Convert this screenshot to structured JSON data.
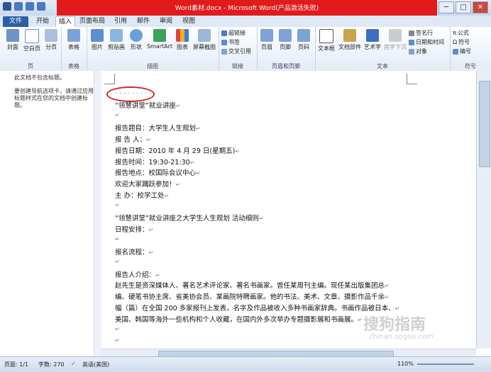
{
  "window": {
    "title": "Word素材.docx - Microsoft Word(产品激活失败)",
    "min": "─",
    "max": "□",
    "close": "✕"
  },
  "tabs": [
    "文件",
    "开始",
    "插入",
    "页面布局",
    "引用",
    "邮件",
    "审阅",
    "视图"
  ],
  "active_tab": "插入",
  "ribbon": {
    "groups": [
      {
        "label": "页",
        "buttons": [
          "封面",
          "空白页",
          "分页"
        ]
      },
      {
        "label": "表格",
        "buttons": [
          "表格"
        ]
      },
      {
        "label": "插图",
        "buttons": [
          "图片",
          "剪贴画",
          "形状",
          "SmartArt",
          "图表",
          "屏幕截图"
        ]
      },
      {
        "label": "链接",
        "buttons": [
          "超链接",
          "书签",
          "交叉引用"
        ]
      },
      {
        "label": "页眉和页脚",
        "buttons": [
          "页眉",
          "页脚",
          "页码"
        ]
      },
      {
        "label": "文本",
        "buttons": [
          "文本框",
          "文档部件",
          "艺术字",
          "首字下沉",
          "签名行",
          "日期和时间",
          "对象"
        ]
      },
      {
        "label": "符号",
        "buttons": [
          "公式",
          "符号",
          "编号"
        ]
      }
    ]
  },
  "nav_pane": {
    "no_headings": "此文档不包含标题。",
    "hint": "要创建导航选项卡，请通过应用标题样式在您的文档中创建标题。"
  },
  "document": {
    "lines": [
      "“领慧讲堂”就业讲座",
      "",
      "报告题目：大学生人生规划",
      "报 告 人：",
      "报告日期：2010 年 4 月 29 日(星期五)",
      "报告时间：19:30-21:30",
      "报告地点：校国际会议中心",
      "欢迎大家踊跃参加！",
      "主 办：校学工处",
      "",
      "“领慧讲堂”就业讲座之大学生人生规划  活动细则",
      "日程安排：",
      "",
      "报名流程：",
      "",
      "报告人介绍：",
      "赵先生是资深媒体人、著名艺术评论家、著名书画家。曾任某周刊主编。现任某出版集团总",
      "编、硬笔书协主席、省美协会员、某画院特聘画家。他的书法、美术、文章、摄影作品千余",
      "幅（篇）在全国 200 多家报刊上发表，名字及作品被收入多种书画家辞典。书画作品被日本、",
      "美国、韩国等海外一些机构和个人收藏，在国内外多次举办专题摄影展和书画展。",
      "",
      ""
    ]
  },
  "status_bar": {
    "page": "页面: 1/1",
    "words": "字数: 270",
    "lang": "英语(美国)",
    "zoom": "110%"
  },
  "watermark": {
    "text": "搜狗指南",
    "url": "zhinan.sogou.com"
  },
  "colors": {
    "title_red": "#e11b1b",
    "file_tab": "#2b5fa9",
    "annotation_circle": "#d42020"
  }
}
